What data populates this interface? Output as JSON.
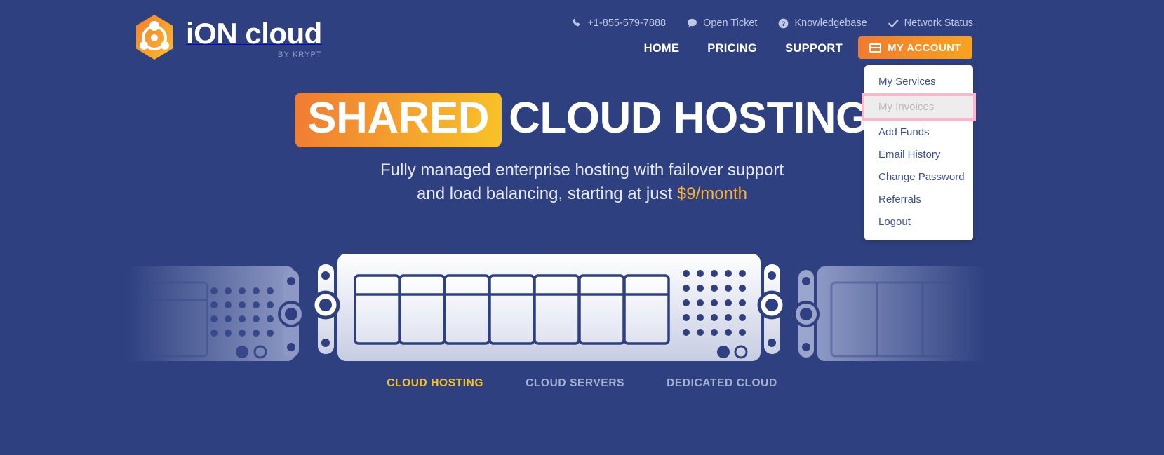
{
  "brand": {
    "name": "iON cloud",
    "name_part1": "iON",
    "name_part2": "cloud",
    "tagline": "BY KRYPT",
    "logo_icon": "hexagon-atom-icon",
    "accent_orange": "#f07a2e",
    "accent_yellow": "#f9c221",
    "background": "#2e4080"
  },
  "topnav": {
    "links": [
      {
        "label": "+1-855-579-7888",
        "icon": "phone-icon"
      },
      {
        "label": "Open Ticket",
        "icon": "chat-bubble-icon"
      },
      {
        "label": "Knowledgebase",
        "icon": "question-circle-icon"
      },
      {
        "label": "Network Status",
        "icon": "check-icon"
      }
    ]
  },
  "mainnav": {
    "items": [
      {
        "label": "HOME"
      },
      {
        "label": "PRICING"
      },
      {
        "label": "SUPPORT"
      }
    ],
    "account_button": {
      "label": "MY ACCOUNT",
      "icon": "wallet-icon"
    }
  },
  "account_dropdown": {
    "open": true,
    "items": [
      {
        "label": "My Services",
        "highlighted": false
      },
      {
        "label": "My Invoices",
        "highlighted": true
      },
      {
        "label": "Add Funds",
        "highlighted": false
      },
      {
        "label": "Email History",
        "highlighted": false
      },
      {
        "label": "Change Password",
        "highlighted": false
      },
      {
        "label": "Referrals",
        "highlighted": false
      },
      {
        "label": "Logout",
        "highlighted": false
      }
    ],
    "highlight_border_color": "#fbb5cd"
  },
  "hero": {
    "headline_badge": "SHARED",
    "headline_rest": "CLOUD HOSTING",
    "subline_line1": "Fully managed enterprise hosting with failover support",
    "subline_line2_prefix": "and load balancing, starting at just ",
    "subline_price": "$9/month"
  },
  "tabs": {
    "items": [
      {
        "label": "CLOUD HOSTING",
        "active": true
      },
      {
        "label": "CLOUD SERVERS",
        "active": false
      },
      {
        "label": "DEDICATED CLOUD",
        "active": false
      }
    ]
  },
  "illustration": {
    "name": "server-rack-illustration"
  }
}
